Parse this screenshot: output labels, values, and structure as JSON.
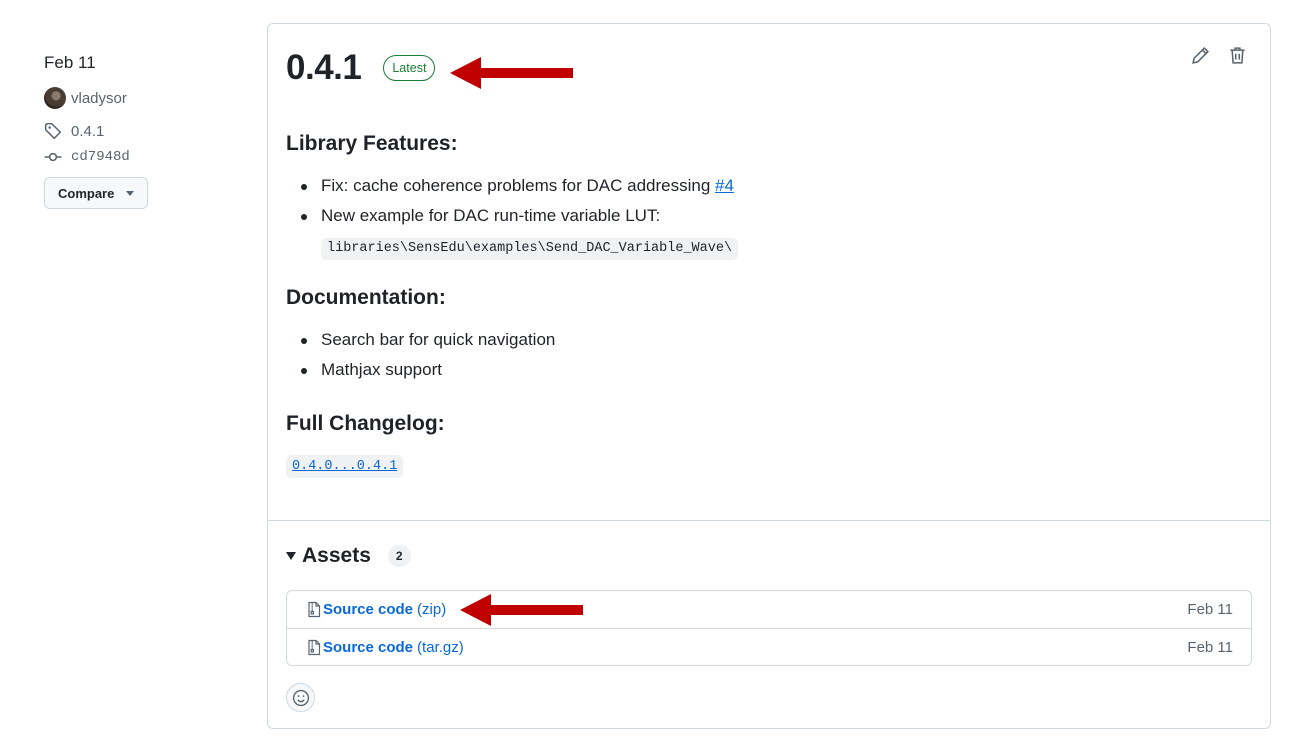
{
  "sidebar": {
    "date": "Feb 11",
    "author": "vladysor",
    "tag": "0.4.1",
    "commit": "cd7948d",
    "compare_label": "Compare"
  },
  "release": {
    "version": "0.4.1",
    "badge": "Latest",
    "sections": {
      "features_heading": "Library Features:",
      "feature_1_text": "Fix: cache coherence problems for DAC addressing ",
      "feature_1_link": "#4",
      "feature_2_text": "New example for DAC run-time variable LUT:",
      "feature_2_code": "libraries\\SensEdu\\examples\\Send_DAC_Variable_Wave\\",
      "docs_heading": "Documentation:",
      "doc_1": "Search bar for quick navigation",
      "doc_2": "Mathjax support",
      "changelog_heading": "Full Changelog:",
      "changelog_link": "0.4.0...0.4.1"
    }
  },
  "assets": {
    "title": "Assets",
    "count": "2",
    "items": [
      {
        "name": "Source code",
        "ext": "(zip)",
        "date": "Feb 11"
      },
      {
        "name": "Source code",
        "ext": "(tar.gz)",
        "date": "Feb 11"
      }
    ]
  },
  "colors": {
    "accent": "#0969da",
    "success": "#1a7f37",
    "annotation_arrow": "#c00000",
    "border": "#d1d9e0"
  },
  "icons": [
    "avatar",
    "tag-icon",
    "commit-icon",
    "pencil-icon",
    "trash-icon",
    "file-zip-icon",
    "smiley-icon",
    "triangle-down-icon"
  ]
}
